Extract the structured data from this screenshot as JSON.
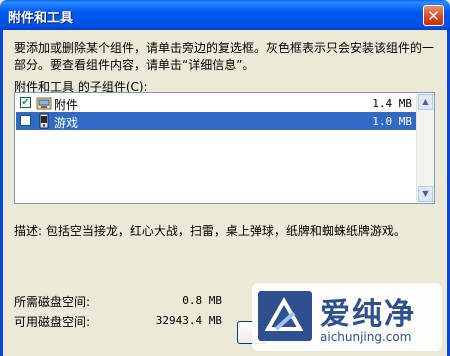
{
  "window": {
    "title": "附件和工具",
    "close_glyph": "✕"
  },
  "description": "要添加或删除某个组件，请单击旁边的复选框。灰色框表示只会安装该组件的一部分。要查看组件内容，请单击“详细信息”。",
  "list": {
    "label": "附件和工具 的子组件(C):",
    "items": [
      {
        "name": "附件",
        "size": "1.4 MB",
        "checked": true,
        "selected": false,
        "icon": "accessories-icon"
      },
      {
        "name": "游戏",
        "size": "1.0 MB",
        "checked": false,
        "selected": true,
        "icon": "games-icon"
      }
    ]
  },
  "detail": "描述:  包括空当接龙，红心大战，扫雷，桌上弹球，纸牌和蜘蛛纸牌游戏。",
  "stats": {
    "required_label": "所需磁盘空间:",
    "required_value": "0.8 MB",
    "available_label": "可用磁盘空间:",
    "available_value": "32943.4 MB"
  },
  "watermark": {
    "brand": "爱纯净",
    "url": "aichunjing.com"
  },
  "colors": {
    "title_bar": "#0058ee",
    "selection": "#316ac5",
    "dialog_bg": "#ece9d8"
  }
}
